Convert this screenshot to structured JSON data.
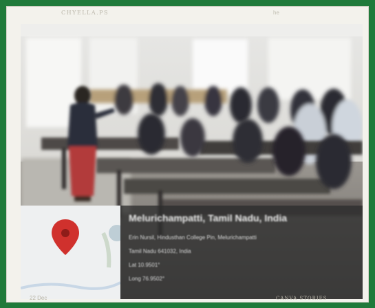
{
  "header": {
    "caption": "CHYELLA.PS",
    "corner_mark": "he"
  },
  "location_stamp": {
    "title": "Melurichampatti, Tamil Nadu, India",
    "address": "Erin Nursil, Hindusthan College Pin, Melurichampatti",
    "region": "Tamil Nadu 641032, India",
    "lat": "Lat 10.9501°",
    "long": "Long 76.9502°"
  },
  "footer": {
    "left": "22 Dec",
    "right": "CANVA STORIES"
  },
  "colors": {
    "border": "#1f7a3a",
    "frame": "#f3f2ec",
    "pin": "#d0312d"
  },
  "icons": [
    "map-pin-icon"
  ]
}
